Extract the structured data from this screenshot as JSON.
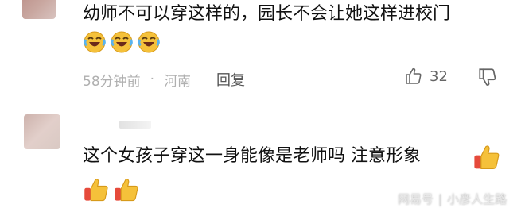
{
  "comments": [
    {
      "text": "幼师不可以穿这样的，园长不会让她这样进校门",
      "emojis": [
        "laugh-cry-emoji",
        "laugh-cry-emoji",
        "laugh-cry-emoji"
      ],
      "time": "58分钟前",
      "separator": "·",
      "location": "河南",
      "reply_label": "回复",
      "like_count": "32"
    },
    {
      "text": "这个女孩子穿这一身能像是老师吗 注意形象",
      "emojis": [
        "thumbs-up-emoji",
        "thumbs-up-emoji",
        "thumbs-up-emoji"
      ]
    }
  ],
  "watermark": {
    "source": "网易号",
    "separator": "|",
    "author": "小彦人生路"
  },
  "colors": {
    "text": "#111111",
    "meta": "#b0b0b0",
    "emoji_yellow": "#f5c13a",
    "emoji_red": "#e64a3b"
  }
}
